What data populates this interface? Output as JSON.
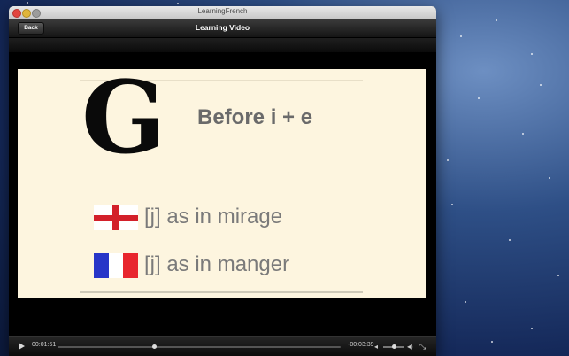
{
  "window": {
    "title": "LearningFrench"
  },
  "navbar": {
    "back_label": "Back",
    "title": "Learning Video"
  },
  "slide": {
    "letter": "G",
    "headline": "Before i + e",
    "rows": [
      {
        "flag": "england-flag",
        "text": "[j] as in mirage"
      },
      {
        "flag": "france-flag",
        "text": "[j] as in manger"
      }
    ]
  },
  "player": {
    "current_time": "00:01:51",
    "remaining_time": "-00:03:39",
    "progress_fraction": 0.34,
    "volume_fraction": 0.5
  },
  "colors": {
    "slide_background": "#fdf5df",
    "headline": "#6a6a6a",
    "england_red": "#d3202a",
    "france_blue": "#2735c8",
    "france_red": "#e8262e"
  }
}
